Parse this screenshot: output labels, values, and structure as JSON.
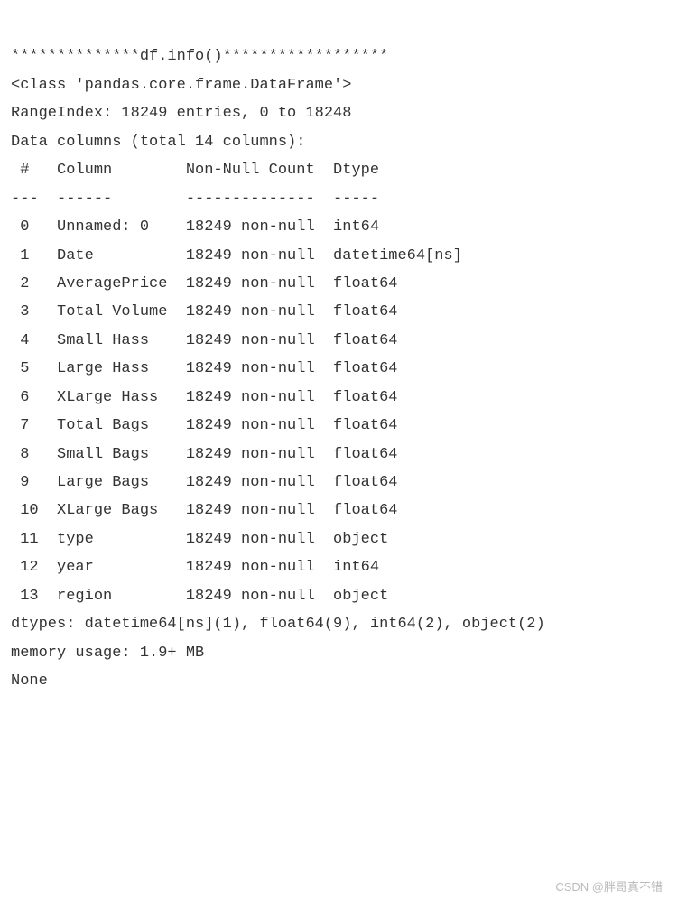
{
  "header": "**************df.info()******************",
  "class_line": "<class 'pandas.core.frame.DataFrame'>",
  "range_index": "RangeIndex: 18249 entries, 0 to 18248",
  "data_columns": "Data columns (total 14 columns):",
  "table_header": " #   Column        Non-Null Count  Dtype",
  "table_sep": "---  ------        --------------  -----",
  "rows": [
    " 0   Unnamed: 0    18249 non-null  int64",
    " 1   Date          18249 non-null  datetime64[ns]",
    " 2   AveragePrice  18249 non-null  float64",
    " 3   Total Volume  18249 non-null  float64",
    " 4   Small Hass    18249 non-null  float64",
    " 5   Large Hass    18249 non-null  float64",
    " 6   XLarge Hass   18249 non-null  float64",
    " 7   Total Bags    18249 non-null  float64",
    " 8   Small Bags    18249 non-null  float64",
    " 9   Large Bags    18249 non-null  float64",
    " 10  XLarge Bags   18249 non-null  float64",
    " 11  type          18249 non-null  object",
    " 12  year          18249 non-null  int64",
    " 13  region        18249 non-null  object"
  ],
  "dtypes": "dtypes: datetime64[ns](1), float64(9), int64(2), object(2)",
  "memory": "memory usage: 1.9+ MB",
  "none": "None",
  "watermark": "CSDN @胖哥真不错"
}
